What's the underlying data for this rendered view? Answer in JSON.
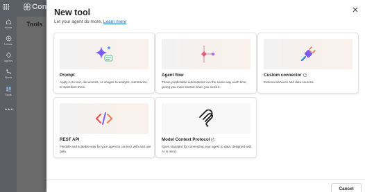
{
  "app": {
    "name": "Conto",
    "page_title": "Tools"
  },
  "rail": {
    "items": [
      {
        "label": "Home",
        "icon": "home-icon"
      },
      {
        "label": "Create",
        "icon": "plus-circle-icon"
      },
      {
        "label": "Agents",
        "icon": "agents-icon"
      },
      {
        "label": "Flows",
        "icon": "flows-icon"
      },
      {
        "label": "Tools",
        "icon": "tools-icon"
      }
    ],
    "more": "•••"
  },
  "dialog": {
    "title": "New tool",
    "subtitle": "Let your agent do more.",
    "learn_more": "Learn more",
    "cards": [
      {
        "title": "Prompt",
        "desc": "Apply AI to text, documents, or images to analyze, summarize, or transform them.",
        "external": false
      },
      {
        "title": "Agent flow",
        "desc": "These predictable automations run the same way each time, giving you more control when you need it.",
        "external": false
      },
      {
        "title": "Custom connector",
        "desc": "External services and data sources.",
        "external": true
      },
      {
        "title": "REST API",
        "desc": "Flexible and scalable way for your agent to connect with and use data.",
        "external": false
      },
      {
        "title": "Model Context Protocol",
        "desc": "Open standard for connecting your agent to data, designed with AI in mind.",
        "external": true
      }
    ],
    "cancel_label": "Cancel"
  },
  "colors": {
    "link": "#0f6cbd",
    "sparkle_purple": "#7a5af8",
    "sparkle_blue": "#3b82f6",
    "plug_orange": "#f07a4a"
  }
}
